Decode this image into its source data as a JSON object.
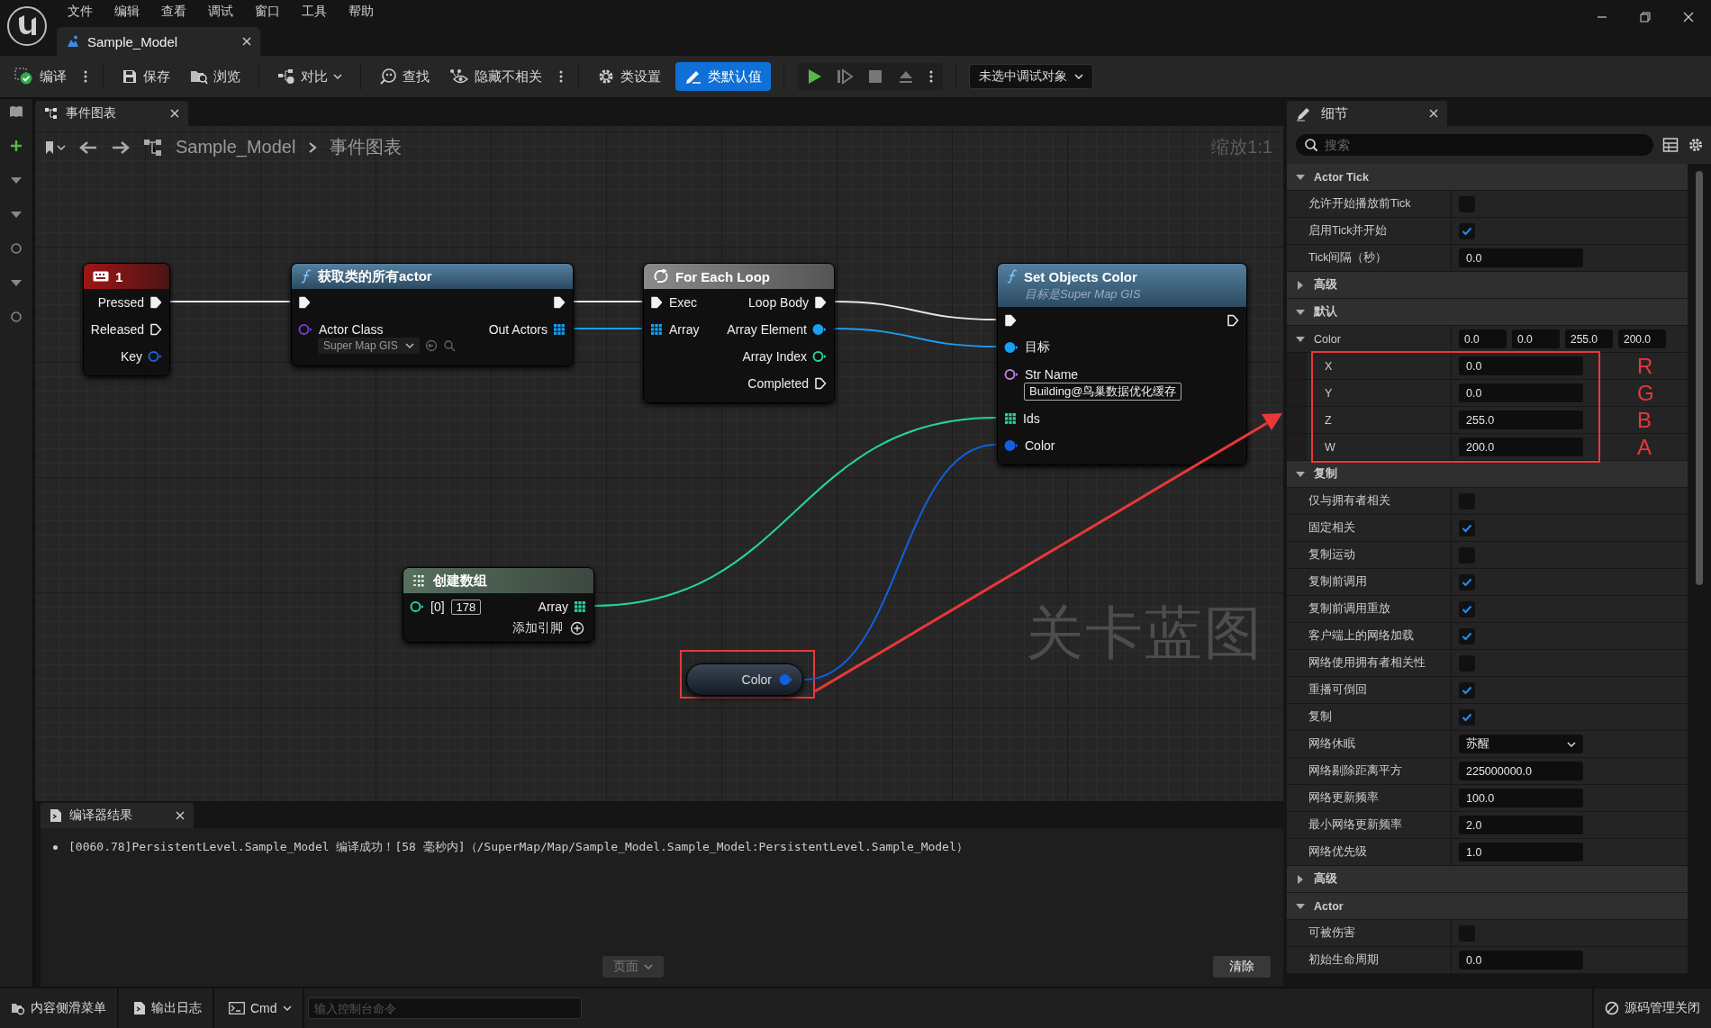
{
  "menu": [
    "文件",
    "编辑",
    "查看",
    "调试",
    "窗口",
    "工具",
    "帮助"
  ],
  "document_tab": {
    "title": "Sample_Model"
  },
  "toolbar": {
    "compile": "编译",
    "save": "保存",
    "browse": "浏览",
    "diff": "对比",
    "find": "查找",
    "hide_unrelated": "隐藏不相关",
    "class_settings": "类设置",
    "class_defaults": {
      "label": "类默认值",
      "selected": true
    },
    "debug_target": "未选中调试对象"
  },
  "graph_tab": {
    "title": "事件图表"
  },
  "breadcrumb": [
    "Sample_Model",
    "事件图表"
  ],
  "zoom": "缩放1:1",
  "graph_label": "关卡蓝图",
  "graph": {
    "nodes": [
      {
        "kind": "event",
        "title": "1",
        "rows": [
          {
            "out": {
              "label": "Pressed",
              "kind": "exec",
              "connected": true
            }
          },
          {
            "out": {
              "label": "Released",
              "kind": "exec",
              "connected": false
            }
          },
          {
            "out": {
              "label": "Key",
              "kind": "data",
              "color": "#1b63d6",
              "connected": false
            }
          }
        ]
      },
      {
        "kind": "function",
        "title": "获取类的所有actor",
        "rows": [
          {
            "in": {
              "kind": "exec",
              "connected": true
            },
            "out": {
              "kind": "exec",
              "connected": true
            }
          },
          {
            "in": {
              "label": "Actor Class",
              "kind": "data",
              "color": "#7a3ad0",
              "connected": false,
              "choice": "Super Map GIS"
            },
            "out": {
              "label": "Out Actors",
              "kind": "array",
              "color": "#19a0f0",
              "connected": true
            }
          }
        ]
      },
      {
        "kind": "macro",
        "title": "For Each Loop",
        "rows": [
          {
            "in": {
              "label": "Exec",
              "kind": "exec",
              "connected": true
            },
            "out": {
              "label": "Loop Body",
              "kind": "exec",
              "connected": true
            }
          },
          {
            "in": {
              "label": "Array",
              "kind": "array",
              "color": "#19a0f0",
              "connected": true
            },
            "out": {
              "label": "Array Element",
              "kind": "data",
              "color": "#19a0f0",
              "connected": true
            }
          },
          {
            "out": {
              "label": "Array Index",
              "kind": "data",
              "color": "#27d2a3",
              "connected": false
            }
          },
          {
            "out": {
              "label": "Completed",
              "kind": "exec",
              "connected": false
            }
          }
        ]
      },
      {
        "kind": "function",
        "title": "Set Objects Color",
        "subtitle": "目标是Super Map GIS",
        "rows": [
          {
            "in": {
              "kind": "exec",
              "connected": true
            },
            "out": {
              "kind": "exec",
              "connected": false
            }
          },
          {
            "in": {
              "label": "目标",
              "kind": "data",
              "color": "#19a0f0",
              "connected": true
            }
          },
          {
            "in": {
              "label": "Str Name",
              "kind": "data",
              "color": "#c47ee6",
              "connected": false,
              "value": "Building@鸟巢数据优化缓存"
            }
          },
          {
            "in": {
              "label": "Ids",
              "kind": "array",
              "color": "#27d2a3",
              "connected": true
            }
          },
          {
            "in": {
              "label": "Color",
              "kind": "data",
              "color": "#1160e0",
              "connected": true
            }
          }
        ]
      },
      {
        "kind": "array",
        "title": "创建数组",
        "rows": [
          {
            "in": {
              "label": "[0]",
              "kind": "data",
              "color": "#27d2a3",
              "connected": false,
              "inline_value": "178"
            },
            "out": {
              "label": "Array",
              "kind": "array",
              "color": "#27d2a3",
              "connected": true
            }
          }
        ],
        "add_pin": "添加引脚"
      },
      {
        "kind": "variable",
        "title": "Color",
        "rows": [
          {
            "out": {
              "kind": "data",
              "color": "#1160e0",
              "connected": true
            }
          }
        ]
      }
    ]
  },
  "compiler": {
    "title": "编译器结果",
    "messages": [
      "[0060.78]PersistentLevel.Sample_Model 编译成功！[58 毫秒内]（/SuperMap/Map/Sample_Model.Sample_Model:PersistentLevel.Sample_Model）"
    ],
    "page_button": "页面",
    "clear_button": "清除"
  },
  "details": {
    "title": "细节",
    "search": {
      "placeholder": "搜索"
    },
    "rows": [
      {
        "kind": "header",
        "label": "Actor Tick",
        "expanded": true
      },
      {
        "kind": "bool",
        "label": "允许开始播放前Tick",
        "checked": false
      },
      {
        "kind": "bool",
        "label": "启用Tick并开始",
        "checked": true
      },
      {
        "kind": "number",
        "label": "Tick间隔（秒）",
        "value": "0.0"
      },
      {
        "kind": "header",
        "label": "高级",
        "expanded": false
      },
      {
        "kind": "header",
        "label": "默认",
        "expanded": true
      },
      {
        "kind": "vector",
        "label": "Color",
        "values": [
          "0.0",
          "0.0",
          "255.0",
          "200.0"
        ],
        "expanded": true,
        "children": [
          {
            "label": "X",
            "value": "0.0",
            "annotation": "R"
          },
          {
            "label": "Y",
            "value": "0.0",
            "annotation": "G"
          },
          {
            "label": "Z",
            "value": "255.0",
            "annotation": "B"
          },
          {
            "label": "W",
            "value": "200.0",
            "annotation": "A"
          }
        ]
      },
      {
        "kind": "header",
        "label": "复制",
        "expanded": true
      },
      {
        "kind": "bool",
        "label": "仅与拥有者相关",
        "checked": false
      },
      {
        "kind": "bool",
        "label": "固定相关",
        "checked": true
      },
      {
        "kind": "bool",
        "label": "复制运动",
        "checked": false
      },
      {
        "kind": "bool",
        "label": "复制前调用",
        "checked": true
      },
      {
        "kind": "bool",
        "label": "复制前调用重放",
        "checked": true
      },
      {
        "kind": "bool",
        "label": "客户端上的网络加载",
        "checked": true
      },
      {
        "kind": "bool",
        "label": "网络使用拥有者相关性",
        "checked": false
      },
      {
        "kind": "bool",
        "label": "重播可倒回",
        "checked": true
      },
      {
        "kind": "bool",
        "label": "复制",
        "checked": true
      },
      {
        "kind": "dropdown",
        "label": "网络休眠",
        "value": "苏醒"
      },
      {
        "kind": "number",
        "label": "网络剔除距离平方",
        "value": "225000000.0"
      },
      {
        "kind": "number",
        "label": "网络更新频率",
        "value": "100.0"
      },
      {
        "kind": "number",
        "label": "最小网络更新频率",
        "value": "2.0"
      },
      {
        "kind": "number",
        "label": "网络优先级",
        "value": "1.0"
      },
      {
        "kind": "header",
        "label": "高级",
        "expanded": false
      },
      {
        "kind": "header",
        "label": "Actor",
        "expanded": true
      },
      {
        "kind": "bool",
        "label": "可被伤害",
        "checked": false
      },
      {
        "kind": "number",
        "label": "初始生命周期",
        "value": "0.0"
      }
    ]
  },
  "status_bar": {
    "content_drawer": "内容侧滑菜单",
    "output_log": "输出日志",
    "cmd": "Cmd",
    "console": {
      "placeholder": "输入控制台命令"
    },
    "source_control": "源码管理关闭"
  }
}
